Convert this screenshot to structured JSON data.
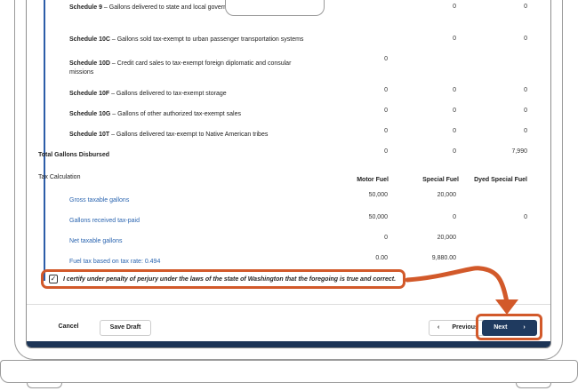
{
  "schedules": [
    {
      "code": "Schedule 9",
      "desc": " – Gallons delivered to state and local government tax-exempt",
      "motor": "0",
      "special": "0",
      "dyed": ""
    },
    {
      "code": "Schedule 10C",
      "desc": " – Gallons sold tax-exempt to urban passenger transportation systems",
      "motor": "",
      "special": "0",
      "dyed": "0"
    },
    {
      "code": "Schedule 10D",
      "desc": " – Credit card sales to tax-exempt foreign diplomatic and consular missions",
      "motor": "0",
      "special": "",
      "dyed": ""
    },
    {
      "code": "Schedule 10F",
      "desc": " – Gallons delivered to tax-exempt storage",
      "motor": "0",
      "special": "0",
      "dyed": "0"
    },
    {
      "code": "Schedule 10G",
      "desc": " – Gallons of other authorized tax-exempt sales",
      "motor": "0",
      "special": "0",
      "dyed": "0"
    },
    {
      "code": "Schedule 10T",
      "desc": " – Gallons delivered tax-exempt to Native American tribes",
      "motor": "0",
      "special": "0",
      "dyed": "0"
    }
  ],
  "schedule9_dyed": "0",
  "total": {
    "label": "Total Gallons Disbursed",
    "motor": "0",
    "special": "0",
    "dyed": "7,990"
  },
  "tax_calc": {
    "heading": "Tax Calculation",
    "columns": [
      "Motor Fuel",
      "Special Fuel",
      "Dyed Special Fuel"
    ],
    "rows": [
      {
        "label": "Gross taxable gallons",
        "motor": "50,000",
        "special": "20,000",
        "dyed": ""
      },
      {
        "label": "Gallons received tax-paid",
        "motor": "50,000",
        "special": "0",
        "dyed": "0"
      },
      {
        "label": "Net taxable gallons",
        "motor": "0",
        "special": "20,000",
        "dyed": ""
      },
      {
        "label": "Fuel tax based on tax rate: 0.494",
        "motor": "0.00",
        "special": "9,880.00",
        "dyed": ""
      }
    ]
  },
  "certify": {
    "checked": "✓",
    "text": "I certify under penalty of perjury under the laws of the state of Washington that the foregoing is true and correct."
  },
  "buttons": {
    "cancel": "Cancel",
    "save_draft": "Save Draft",
    "previous": "Previous",
    "previous_icon": "‹",
    "next": "Next",
    "next_icon": "›"
  },
  "colors": {
    "accent": "#d2592a",
    "link": "#2b65b0",
    "primary": "#1f3a5f",
    "rule": "#2c5da8"
  },
  "icons": [
    "check-icon",
    "chevron-left-icon",
    "chevron-right-icon",
    "curved-arrow-annotation"
  ]
}
